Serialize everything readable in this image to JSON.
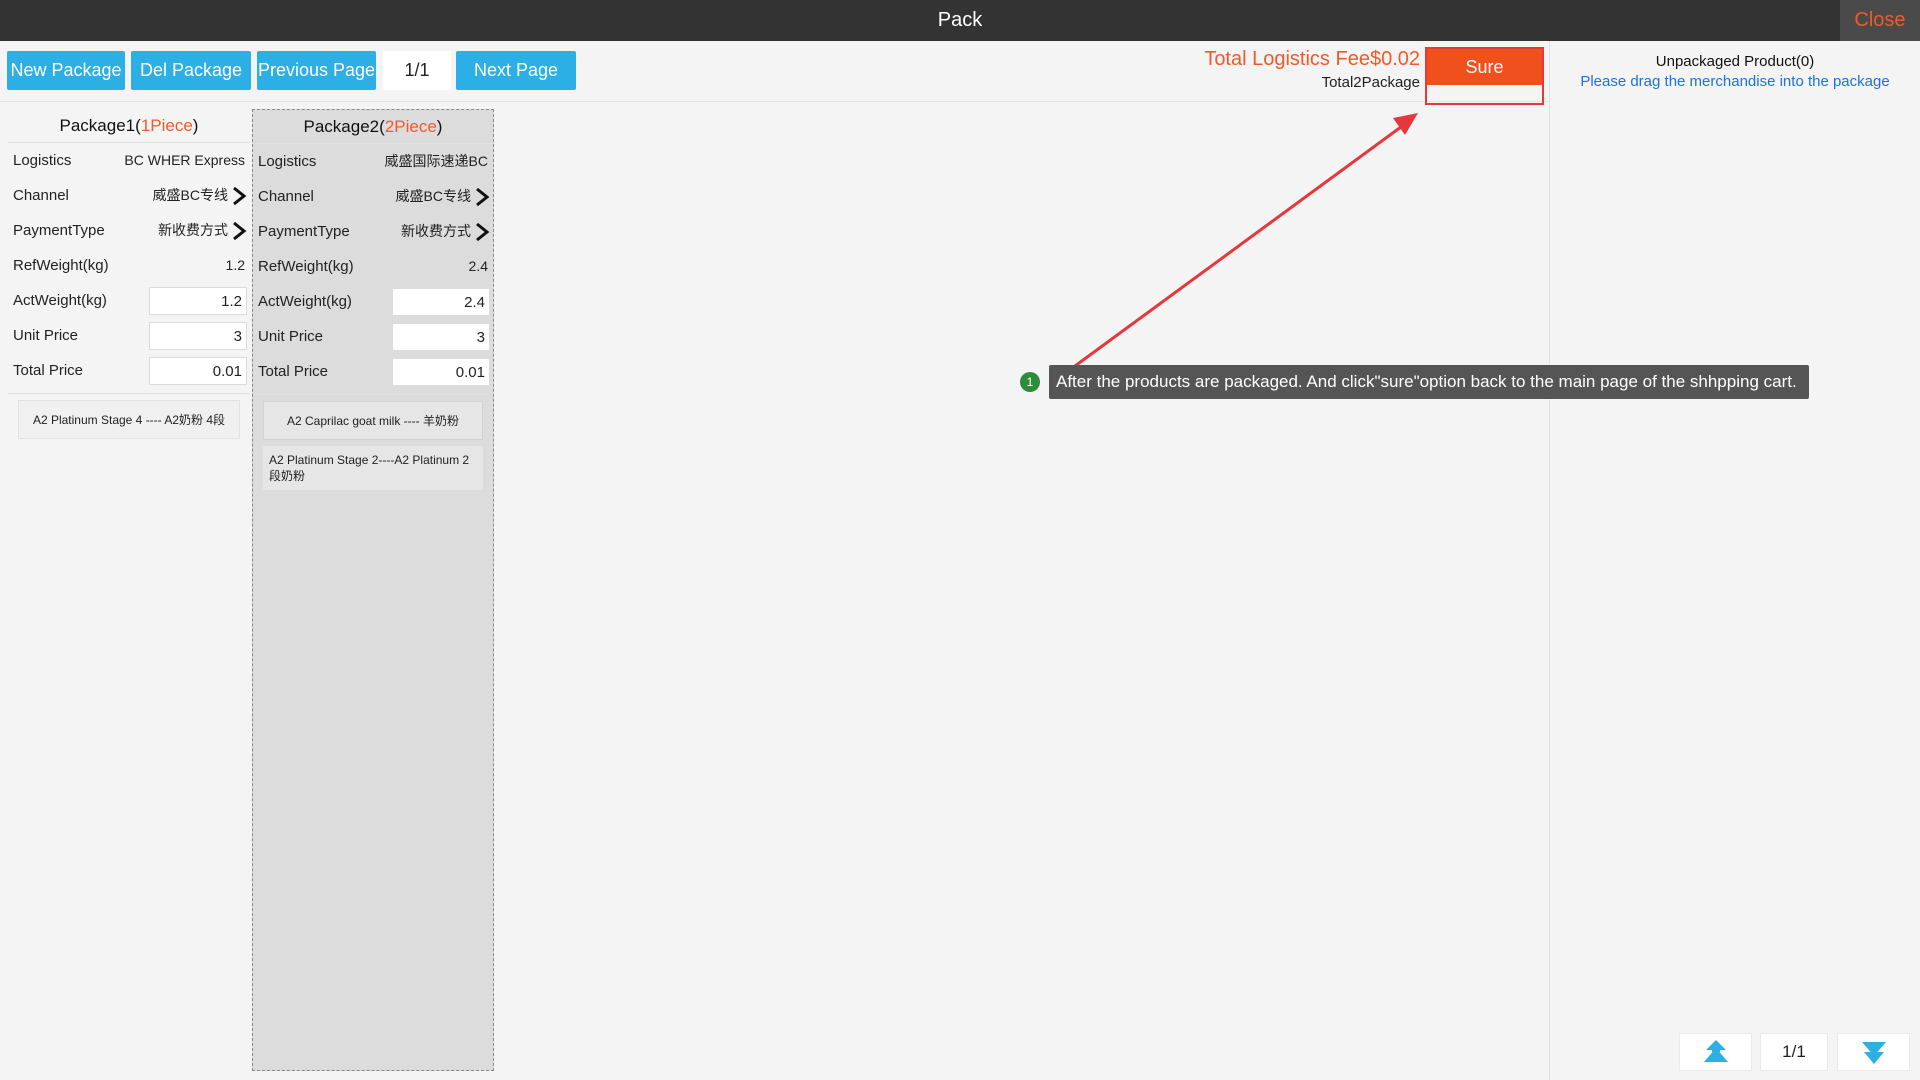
{
  "window": {
    "title": "Pack",
    "close_label": "Close"
  },
  "toolbar": {
    "new_package": "New Package",
    "del_package": "Del Package",
    "previous_page": "Previous Page",
    "page_indicator": "1/1",
    "next_page": "Next Page"
  },
  "summary": {
    "total_fee": "Total Logistics Fee$0.02",
    "total_packages": "Total2Package",
    "sure_label": "Sure"
  },
  "unpacked": {
    "title": "Unpackaged Product(0)",
    "hint": "Please drag the merchandise into the package"
  },
  "packages": [
    {
      "name": "Package1",
      "pieces": "1Piece",
      "logistics_label": "Logistics",
      "logistics": "BC WHER Express",
      "channel_label": "Channel",
      "channel": "威盛BC专线",
      "payment_label": "PaymentType",
      "payment": "新收费方式",
      "refweight_label": "RefWeight(kg)",
      "refweight": "1.2",
      "actweight_label": "ActWeight(kg)",
      "actweight": "1.2",
      "unitprice_label": "Unit Price",
      "unitprice": "3",
      "totalprice_label": "Total Price",
      "totalprice": "0.01",
      "products": [
        "A2 Platinum Stage 4 ---- A2奶粉 4段"
      ]
    },
    {
      "name": "Package2",
      "pieces": "2Piece",
      "logistics_label": "Logistics",
      "logistics": "威盛国际速递BC",
      "channel_label": "Channel",
      "channel": "威盛BC专线",
      "payment_label": "PaymentType",
      "payment": "新收费方式",
      "refweight_label": "RefWeight(kg)",
      "refweight": "2.4",
      "actweight_label": "ActWeight(kg)",
      "actweight": "2.4",
      "unitprice_label": "Unit Price",
      "unitprice": "3",
      "totalprice_label": "Total Price",
      "totalprice": "0.01",
      "products": [
        "A2 Caprilac goat milk ---- 羊奶粉",
        "A2 Platinum Stage 2----A2 Platinum 2段奶粉"
      ]
    }
  ],
  "annotation": {
    "badge": "1",
    "text": "After the products are packaged. And click\"sure\"option back to the main page of the shhpping cart.",
    "color": "#e4393c"
  },
  "bottom_nav": {
    "page": "1/1",
    "up_icon": "double-chevron-up-icon",
    "down_icon": "double-chevron-down-icon"
  },
  "colors": {
    "accent_blue": "#2bafe4",
    "accent_orange": "#f05a28",
    "titlebar": "#333333"
  }
}
